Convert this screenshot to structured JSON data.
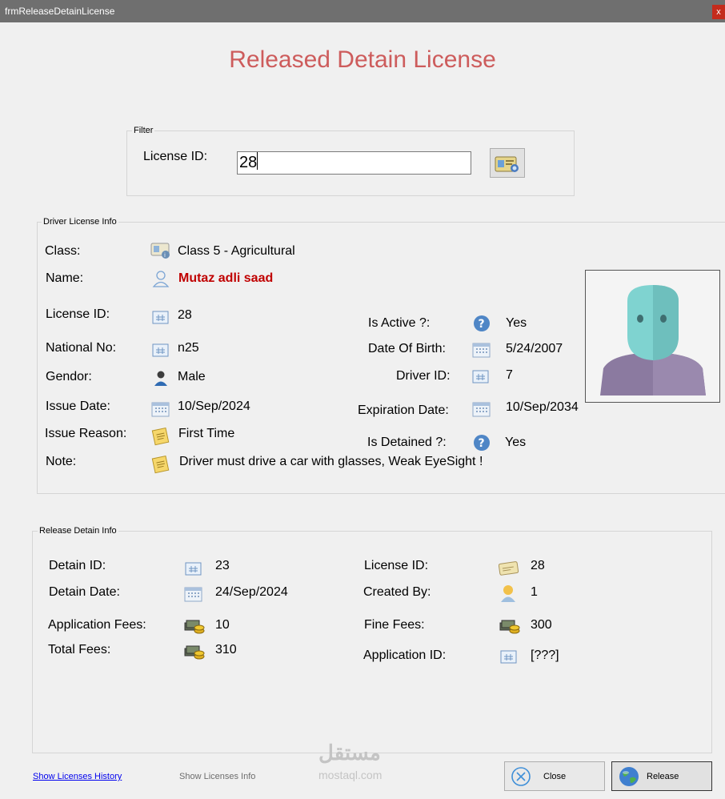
{
  "window": {
    "title": "frmReleaseDetainLicense",
    "close_glyph": "x"
  },
  "heading": "Released Detain License",
  "filter": {
    "legend": "Filter",
    "label": "License ID:",
    "value": "28"
  },
  "driver_info": {
    "legend": "Driver License Info",
    "class_label": "Class:",
    "class_value": "Class 5 - Agricultural",
    "name_label": "Name:",
    "name_value": "Mutaz adli  saad",
    "license_id_label": "License ID:",
    "license_id_value": "28",
    "national_no_label": "National No:",
    "national_no_value": "n25",
    "gender_label": "Gendor:",
    "gender_value": "Male",
    "issue_date_label": "Issue Date:",
    "issue_date_value": "10/Sep/2024",
    "issue_reason_label": "Issue Reason:",
    "issue_reason_value": "First Time",
    "note_label": "Note:",
    "note_value": "Driver must drive a car with glasses, Weak EyeSight !",
    "is_active_label": "Is Active ?:",
    "is_active_value": "Yes",
    "dob_label": "Date Of Birth:",
    "dob_value": "5/24/2007",
    "driver_id_label": "Driver ID:",
    "driver_id_value": "7",
    "expiration_label": "Expiration Date:",
    "expiration_value": "10/Sep/2034",
    "is_detained_label": "Is Detained ?:",
    "is_detained_value": "Yes"
  },
  "release_info": {
    "legend": "Release Detain Info",
    "detain_id_label": "Detain ID:",
    "detain_id_value": "23",
    "detain_date_label": "Detain Date:",
    "detain_date_value": "24/Sep/2024",
    "app_fees_label": "Application Fees:",
    "app_fees_value": "10",
    "total_fees_label": "Total Fees:",
    "total_fees_value": "310",
    "license_id_label": "License ID:",
    "license_id_value": "28",
    "created_by_label": "Created By:",
    "created_by_value": "1",
    "fine_fees_label": "Fine Fees:",
    "fine_fees_value": "300",
    "application_id_label": "Application ID:",
    "application_id_value": "[???]"
  },
  "footer": {
    "history_link": "Show Licenses History",
    "info_link": "Show Licenses Info",
    "close_label": "Close",
    "release_label": "Release"
  },
  "watermark": {
    "arabic": "مستقل",
    "latin": "mostaql.com"
  }
}
